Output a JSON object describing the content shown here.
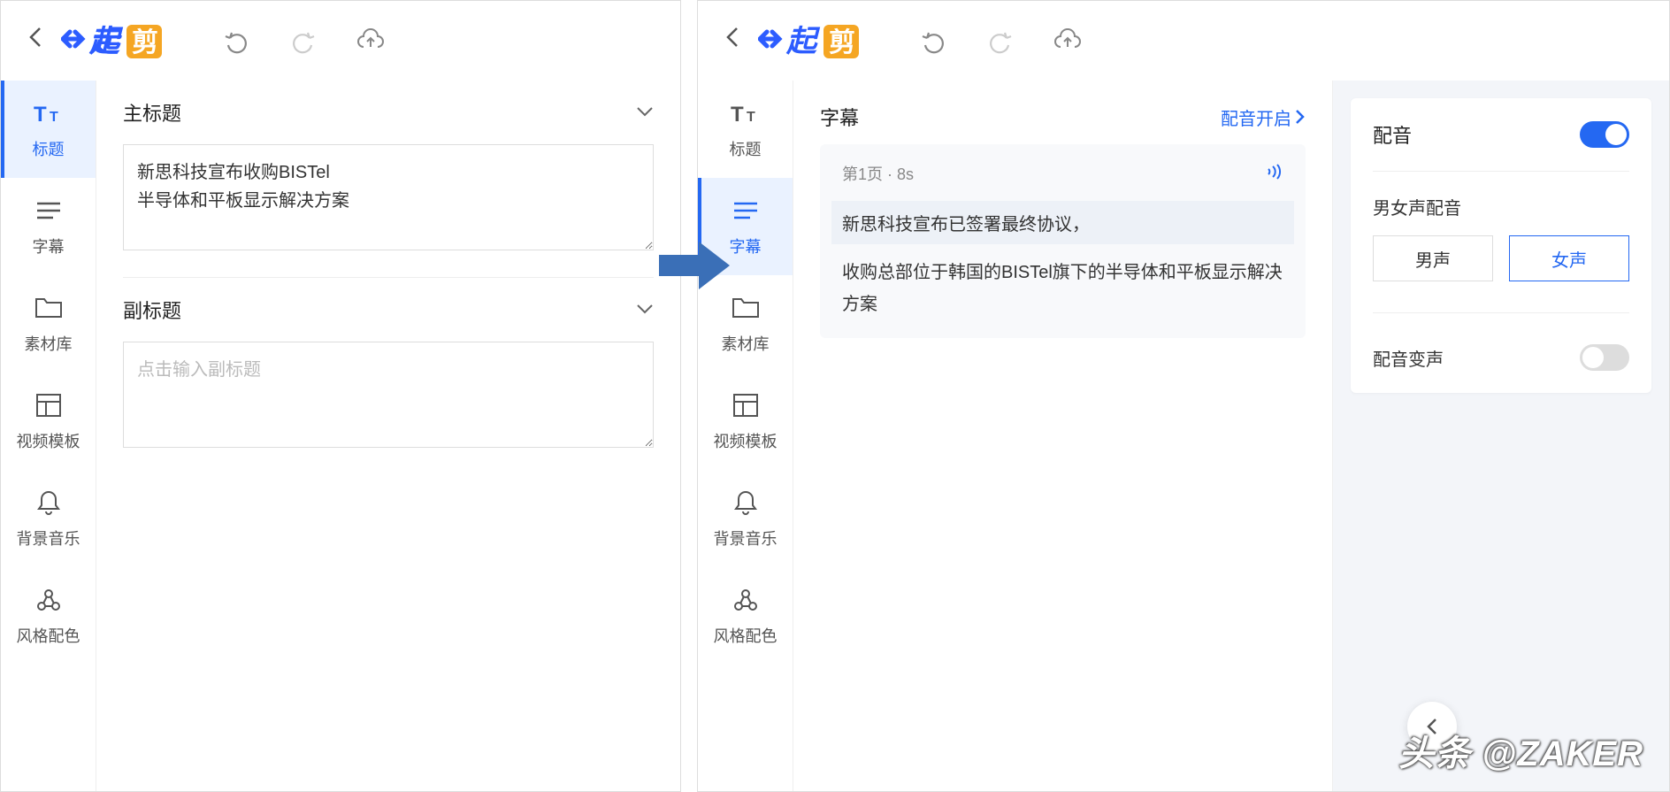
{
  "sidebar": {
    "items": [
      {
        "label": "标题"
      },
      {
        "label": "字幕"
      },
      {
        "label": "素材库"
      },
      {
        "label": "视频模板"
      },
      {
        "label": "背景音乐"
      },
      {
        "label": "风格配色"
      }
    ]
  },
  "left": {
    "mainTitle": {
      "label": "主标题",
      "value": "新思科技宣布收购BISTel\n半导体和平板显示解决方案"
    },
    "subTitle": {
      "label": "副标题",
      "placeholder": "点击输入副标题"
    }
  },
  "right": {
    "subtitleHeader": "字幕",
    "voiceLink": "配音开启",
    "page": {
      "meta": "第1页 · 8s",
      "line1": "新思科技宣布已签署最终协议，",
      "line2": "收购总部位于韩国的BISTel旗下的半导体和平板显示解决方案"
    },
    "voicePanel": {
      "title": "配音",
      "genderLabel": "男女声配音",
      "male": "男声",
      "female": "女声",
      "voiceChange": "配音变声"
    }
  },
  "watermark": "头条 @ZAKER"
}
